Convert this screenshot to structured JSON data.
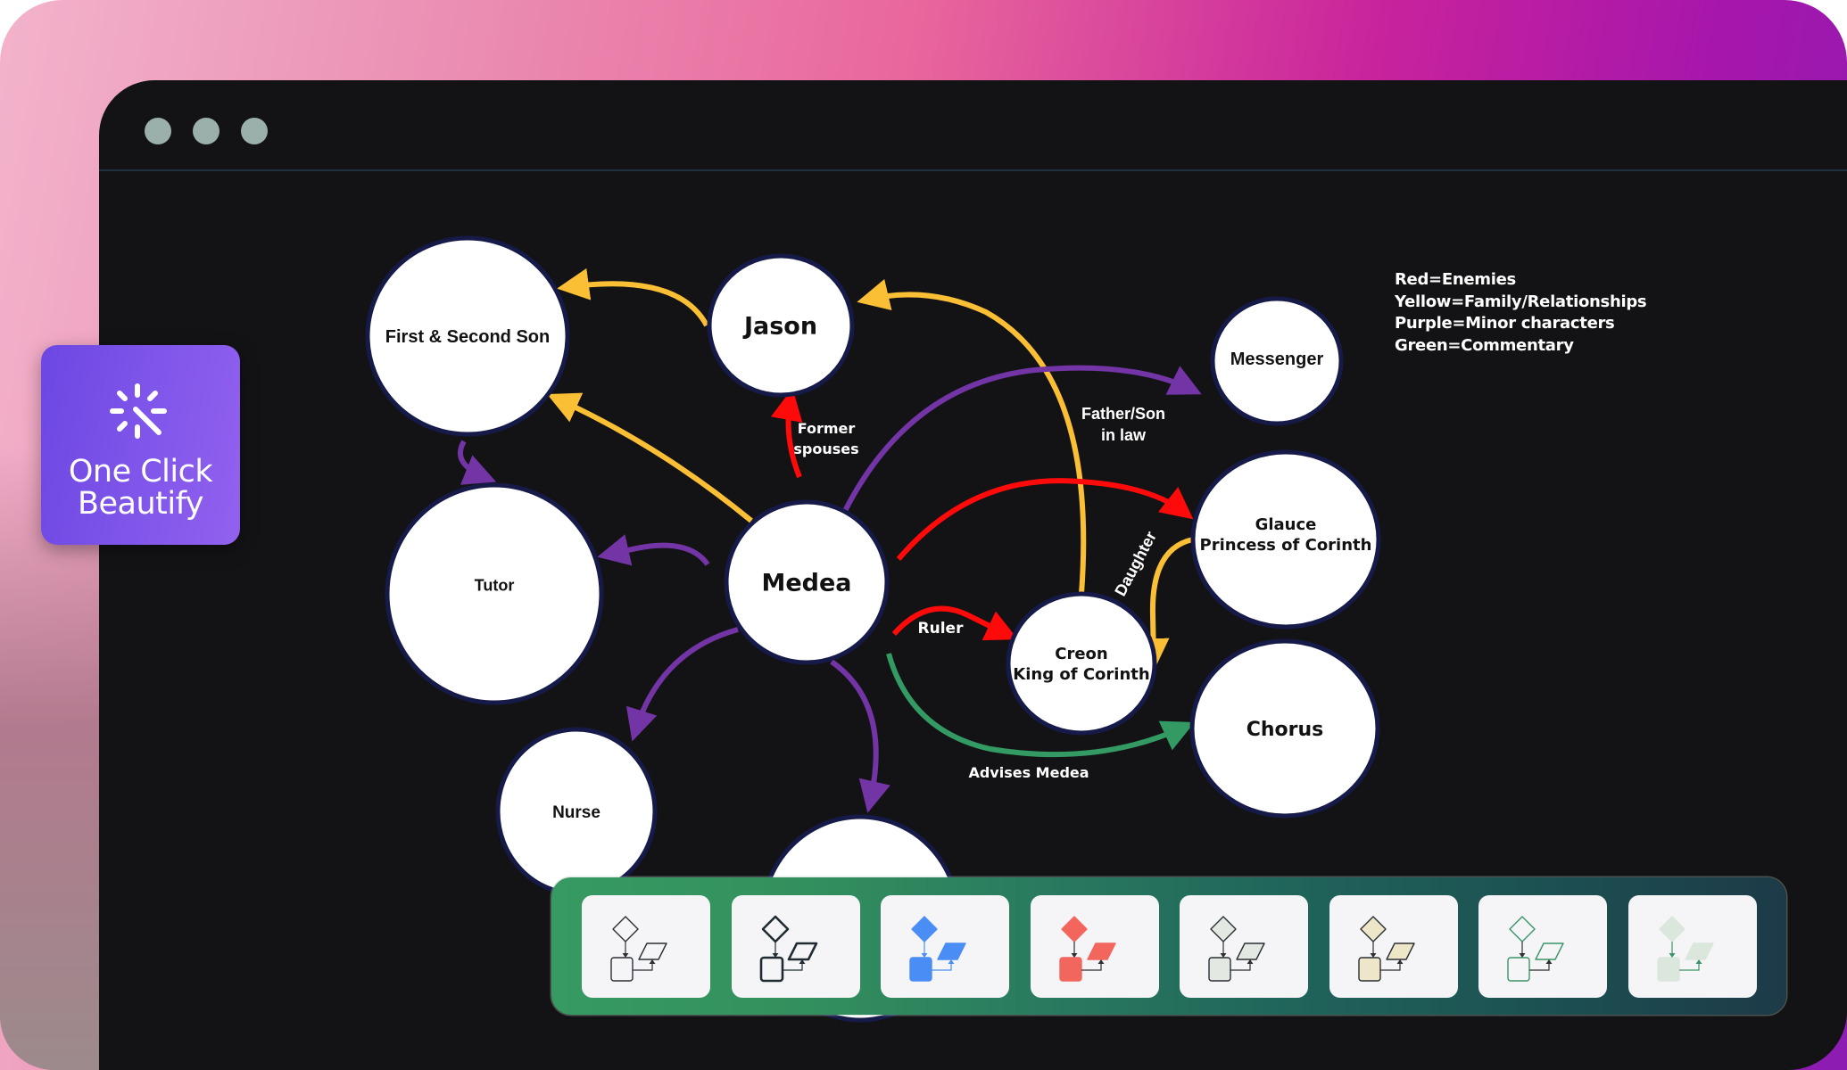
{
  "window": {
    "controls": [
      "close",
      "minimize",
      "maximize"
    ]
  },
  "beautify_button": {
    "label_line1": "One Click",
    "label_line2": "Beautify",
    "icon": "magic-wand-sparkle-icon"
  },
  "legend": {
    "lines": [
      "Red=Enemies",
      "Yellow=Family/Relationships",
      "Purple=Minor characters",
      "Green=Commentary"
    ]
  },
  "colors": {
    "enemies": "#ff0a0a",
    "family": "#fbbf36",
    "minor": "#7334a6",
    "commentary": "#349a63",
    "node_fill": "#ffffff",
    "node_stroke": "#161a48"
  },
  "diagram": {
    "nodes": {
      "son": {
        "lines": [
          "First & Second Son"
        ]
      },
      "jason": {
        "lines": [
          "Jason"
        ]
      },
      "tutor": {
        "lines": [
          "Tutor"
        ]
      },
      "medea": {
        "lines": [
          "Medea"
        ]
      },
      "nurse": {
        "lines": [
          "Nurse"
        ]
      },
      "hidden": {
        "lines": []
      },
      "messenger": {
        "lines": [
          "Messenger"
        ]
      },
      "glauce": {
        "lines": [
          "Glauce",
          "Princess of Corinth"
        ]
      },
      "creon": {
        "lines": [
          "Creon",
          "King of Corinth"
        ]
      },
      "chorus": {
        "lines": [
          "Chorus"
        ]
      }
    },
    "edges": [
      {
        "id": "jason-son",
        "type": "family",
        "from": "Jason",
        "to": "First & Second Son"
      },
      {
        "id": "medea-son",
        "type": "family",
        "from": "Medea",
        "to": "First & Second Son"
      },
      {
        "id": "son-tutor",
        "type": "minor",
        "from": "First & Second Son",
        "to": "Tutor"
      },
      {
        "id": "medea-jason",
        "type": "enemies",
        "from": "Medea",
        "to": "Jason",
        "label": [
          "Former",
          "spouses"
        ]
      },
      {
        "id": "creon-jason",
        "type": "family",
        "from": "Creon",
        "to": "Jason",
        "label": [
          "Father/Son",
          "in law"
        ]
      },
      {
        "id": "medea-messenger",
        "type": "minor",
        "from": "Medea",
        "to": "Messenger"
      },
      {
        "id": "medea-glauce",
        "type": "enemies",
        "from": "Medea",
        "to": "Glauce"
      },
      {
        "id": "glauce-creon",
        "type": "family",
        "from": "Glauce",
        "to": "Creon",
        "label": [
          "Daughter"
        ]
      },
      {
        "id": "medea-creon",
        "type": "enemies",
        "from": "Medea",
        "to": "Creon",
        "label": [
          "Ruler"
        ]
      },
      {
        "id": "medea-chorus",
        "type": "commentary",
        "from": "Medea",
        "to": "Chorus",
        "label": [
          "Advises Medea"
        ]
      },
      {
        "id": "medea-tutor",
        "type": "minor",
        "from": "Medea",
        "to": "Tutor"
      },
      {
        "id": "medea-nurse",
        "type": "minor",
        "from": "Medea",
        "to": "Nurse"
      },
      {
        "id": "medea-hidden",
        "type": "minor",
        "from": "Medea",
        "to": "(hidden node)"
      }
    ]
  },
  "theme_strip": {
    "themes": [
      {
        "name": "outline-thin",
        "fill": "none",
        "stroke": "#2a2f33",
        "arrow": "#2a2f33"
      },
      {
        "name": "outline-bold",
        "fill": "none",
        "stroke": "#1f2d33",
        "arrow": "#1f2d33"
      },
      {
        "name": "blue-filled",
        "fill": "#4a8ef5",
        "stroke": "#4a8ef5",
        "arrow": "#4a8ef5"
      },
      {
        "name": "red-filled",
        "fill": "#f2665e",
        "stroke": "#f2665e",
        "arrow": "#2a2f33"
      },
      {
        "name": "gray-filled",
        "fill": "#e3e8e3",
        "stroke": "#2a2f33",
        "arrow": "#2a2f33"
      },
      {
        "name": "beige-filled",
        "fill": "#eee6c8",
        "stroke": "#2a2f33",
        "arrow": "#2a2f33"
      },
      {
        "name": "green-outline",
        "fill": "none",
        "stroke": "#3a9466",
        "arrow": "#2a2f33"
      },
      {
        "name": "mint-soft",
        "fill": "#dbe6dd",
        "stroke": "#dbe6dd",
        "arrow": "#3a9466"
      }
    ]
  }
}
